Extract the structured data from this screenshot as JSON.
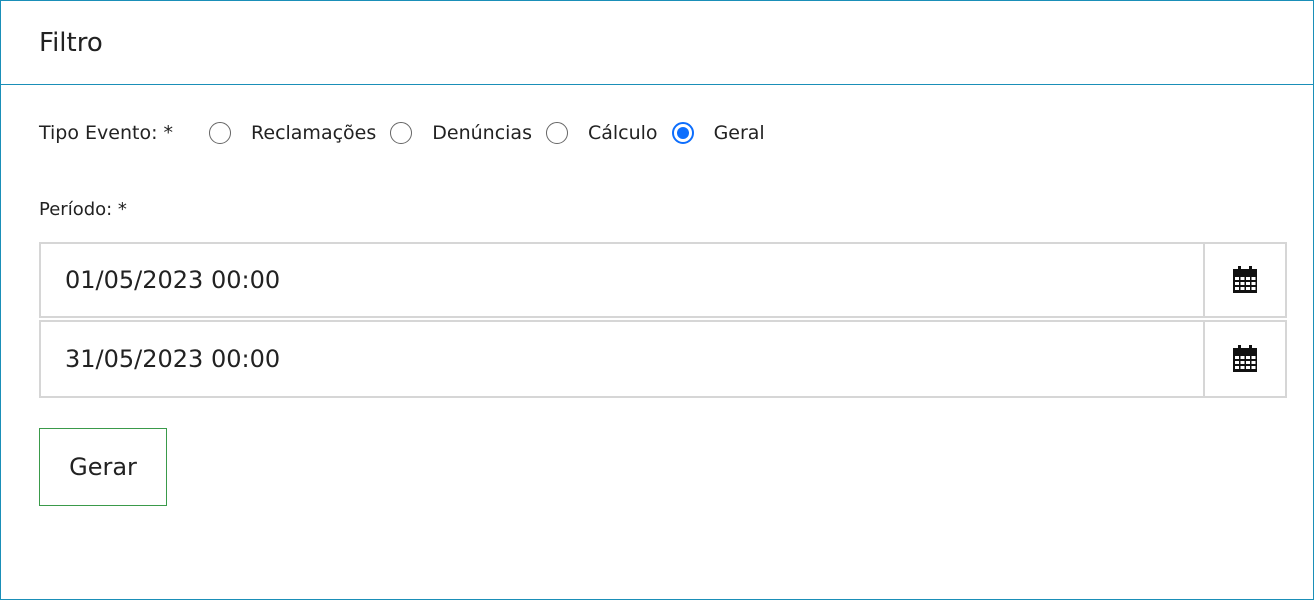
{
  "panel": {
    "title": "Filtro"
  },
  "tipo_evento": {
    "label": "Tipo Evento: *",
    "options": [
      {
        "label": "Reclamações",
        "checked": false
      },
      {
        "label": "Denúncias",
        "checked": false
      },
      {
        "label": "Cálculo",
        "checked": false
      },
      {
        "label": "Geral",
        "checked": true
      }
    ]
  },
  "periodo": {
    "label": "Período: *",
    "start_value": "01/05/2023 00:00",
    "end_value": "31/05/2023 00:00"
  },
  "actions": {
    "gerar_label": "Gerar"
  },
  "colors": {
    "panel_border": "#1a8fb8",
    "radio_checked": "#0d6efd",
    "gerar_border": "#3a9a4a"
  },
  "icons": {
    "date_picker": "calendar-icon"
  }
}
